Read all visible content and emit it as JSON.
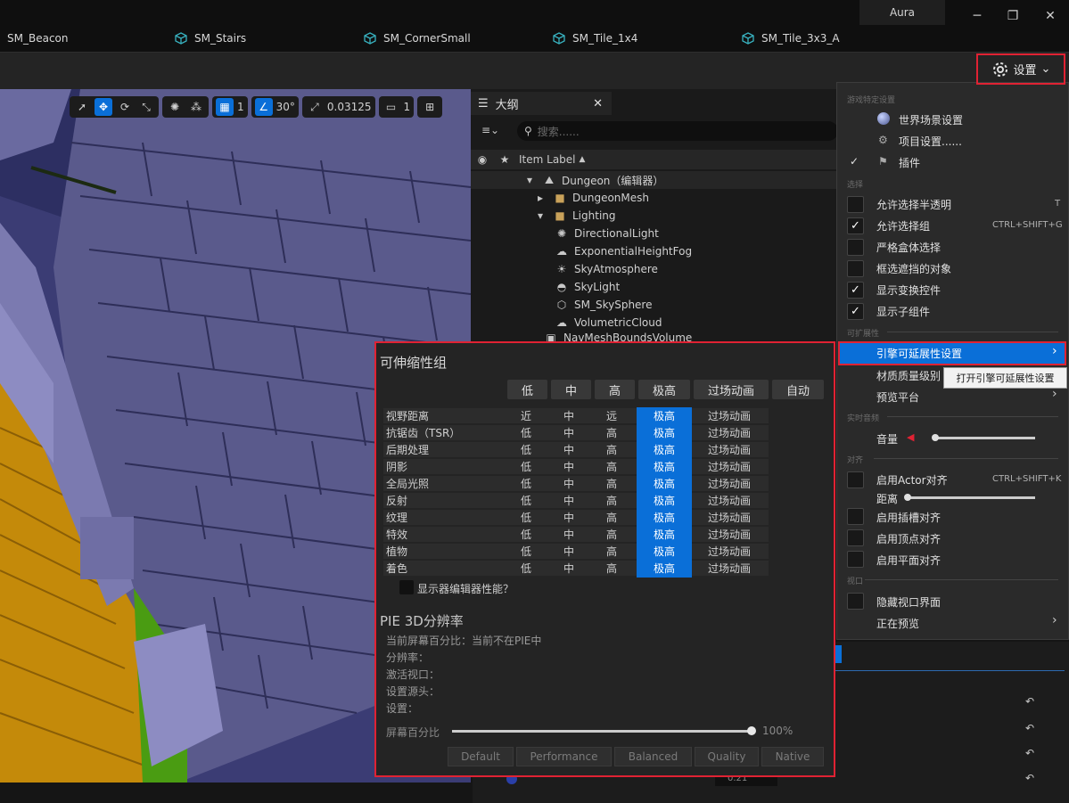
{
  "app": {
    "account": "Aura"
  },
  "tabs": [
    "SM_Beacon",
    "SM_Stairs",
    "SM_CornerSmall",
    "SM_Tile_1x4",
    "SM_Tile_3x3_A"
  ],
  "toolbar": {
    "settings_label": "设置"
  },
  "viewport": {
    "grid_size": "1",
    "rotation_snap": "30°",
    "scale_snap": "0.03125",
    "camera_speed": "1"
  },
  "outliner": {
    "tab_label": "大纲",
    "search_placeholder": "搜索......",
    "column_label": "Item Label",
    "rows": [
      {
        "label": "Dungeon（编辑器）"
      },
      {
        "label": "DungeonMesh"
      },
      {
        "label": "Lighting"
      },
      {
        "label": "DirectionalLight"
      },
      {
        "label": "ExponentialHeightFog"
      },
      {
        "label": "SkyAtmosphere"
      },
      {
        "label": "SkyLight"
      },
      {
        "label": "SM_SkySphere"
      },
      {
        "label": "VolumetricCloud"
      },
      {
        "label": "NavMeshBoundsVolume"
      }
    ]
  },
  "scalability": {
    "title": "可伸缩性组",
    "levels": [
      "低",
      "中",
      "高",
      "极高",
      "过场动画",
      "自动"
    ],
    "rows": [
      {
        "name": "视野距离",
        "c1": "近",
        "c2": "中",
        "c3": "远",
        "c4": "极高",
        "c5": "过场动画"
      },
      {
        "name": "抗锯齿（TSR）",
        "c1": "低",
        "c2": "中",
        "c3": "高",
        "c4": "极高",
        "c5": "过场动画"
      },
      {
        "name": "后期处理",
        "c1": "低",
        "c2": "中",
        "c3": "高",
        "c4": "极高",
        "c5": "过场动画"
      },
      {
        "name": "阴影",
        "c1": "低",
        "c2": "中",
        "c3": "高",
        "c4": "极高",
        "c5": "过场动画"
      },
      {
        "name": "全局光照",
        "c1": "低",
        "c2": "中",
        "c3": "高",
        "c4": "极高",
        "c5": "过场动画"
      },
      {
        "name": "反射",
        "c1": "低",
        "c2": "中",
        "c3": "高",
        "c4": "极高",
        "c5": "过场动画"
      },
      {
        "name": "纹理",
        "c1": "低",
        "c2": "中",
        "c3": "高",
        "c4": "极高",
        "c5": "过场动画"
      },
      {
        "name": "特效",
        "c1": "低",
        "c2": "中",
        "c3": "高",
        "c4": "极高",
        "c5": "过场动画"
      },
      {
        "name": "植物",
        "c1": "低",
        "c2": "中",
        "c3": "高",
        "c4": "极高",
        "c5": "过场动画"
      },
      {
        "name": "着色",
        "c1": "低",
        "c2": "中",
        "c3": "高",
        "c4": "极高",
        "c5": "过场动画"
      }
    ],
    "monitor_perf_label": "显示器编辑器性能？",
    "pie_title": "PIE 3D分辨率",
    "pie_lines": [
      "当前屏幕百分比：当前不在PIE中",
      "分辨率：",
      "激活视口：",
      "设置源头：",
      "设置："
    ],
    "screen_pct_label": "屏幕百分比",
    "screen_pct_value": "100%",
    "presets": [
      "Default",
      "Performance",
      "Balanced",
      "Quality",
      "Native"
    ]
  },
  "menu": {
    "sec_game": "游戏特定设置",
    "world_settings": "世界场景设置",
    "project_settings": "项目设置......",
    "plugins": "插件",
    "sec_select": "选择",
    "allow_translucent": "允许选择半透明",
    "allow_translucent_key": "T",
    "allow_groups": "允许选择组",
    "allow_groups_key": "CTRL+SHIFT+G",
    "strict_box": "严格盒体选择",
    "box_occluded": "框选遮挡的对象",
    "show_transform": "显示变换控件",
    "show_subcomponents": "显示子组件",
    "sec_scal": "可扩展性",
    "engine_scalability": "引擎可延展性设置",
    "tooltip": "打开引擎可延展性设置",
    "material_quality": "材质质量级别",
    "preview_platform": "预览平台",
    "sec_audio": "实时音频",
    "volume": "音量",
    "sec_snap": "对齐",
    "actor_snap": "启用Actor对齐",
    "actor_snap_key": "CTRL+SHIFT+K",
    "distance": "距离",
    "socket_snap": "启用插槽对齐",
    "vertex_snap": "启用顶点对齐",
    "plane_snap": "启用平面对齐",
    "sec_viewport": "视口",
    "hide_viewport_ui": "隐藏视口界面",
    "previewing": "正在预览"
  },
  "details": {
    "value_text": "0.21"
  }
}
